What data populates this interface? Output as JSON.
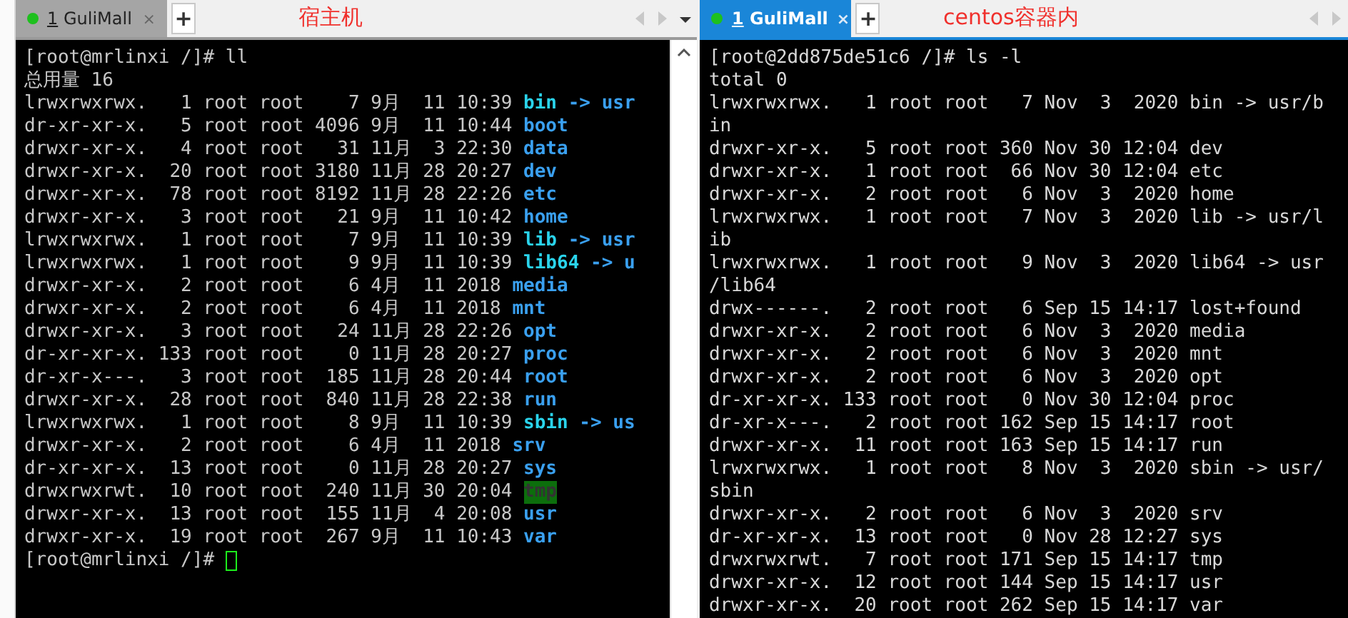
{
  "panes": [
    {
      "tab": {
        "number": "1",
        "label": "GuliMall",
        "close": "×",
        "selected": false
      },
      "add": "+",
      "note": "宿主机",
      "scrollbar": true,
      "lines": [
        {
          "text": "[root@mrlinxi /]# ll"
        },
        {
          "text": "总用量 16"
        },
        {
          "text": "lrwxrwxrwx.   1 root root    7 9月  11 10:39 ",
          "name": "bin",
          "kind": "link",
          "target": " -> usr"
        },
        {
          "text": "dr-xr-xr-x.   5 root root 4096 9月  11 10:44 ",
          "name": "boot",
          "kind": "dir"
        },
        {
          "text": "drwxr-xr-x.   4 root root   31 11月  3 22:30 ",
          "name": "data",
          "kind": "dir"
        },
        {
          "text": "drwxr-xr-x.  20 root root 3180 11月 28 20:27 ",
          "name": "dev",
          "kind": "dir"
        },
        {
          "text": "drwxr-xr-x.  78 root root 8192 11月 28 22:26 ",
          "name": "etc",
          "kind": "dir"
        },
        {
          "text": "drwxr-xr-x.   3 root root   21 9月  11 10:42 ",
          "name": "home",
          "kind": "dir"
        },
        {
          "text": "lrwxrwxrwx.   1 root root    7 9月  11 10:39 ",
          "name": "lib",
          "kind": "link",
          "target": " -> usr"
        },
        {
          "text": "lrwxrwxrwx.   1 root root    9 9月  11 10:39 ",
          "name": "lib64",
          "kind": "link",
          "target": " -> u"
        },
        {
          "text": "drwxr-xr-x.   2 root root    6 4月  11 2018 ",
          "name": "media",
          "kind": "dir"
        },
        {
          "text": "drwxr-xr-x.   2 root root    6 4月  11 2018 ",
          "name": "mnt",
          "kind": "dir"
        },
        {
          "text": "drwxr-xr-x.   3 root root   24 11月 28 22:26 ",
          "name": "opt",
          "kind": "dir"
        },
        {
          "text": "dr-xr-xr-x. 133 root root    0 11月 28 20:27 ",
          "name": "proc",
          "kind": "dir"
        },
        {
          "text": "dr-xr-x---.   3 root root  185 11月 28 20:44 ",
          "name": "root",
          "kind": "dir"
        },
        {
          "text": "drwxr-xr-x.  28 root root  840 11月 28 22:38 ",
          "name": "run",
          "kind": "dir"
        },
        {
          "text": "lrwxrwxrwx.   1 root root    8 9月  11 10:39 ",
          "name": "sbin",
          "kind": "link",
          "target": " -> us"
        },
        {
          "text": "drwxr-xr-x.   2 root root    6 4月  11 2018 ",
          "name": "srv",
          "kind": "dir"
        },
        {
          "text": "dr-xr-xr-x.  13 root root    0 11月 28 20:27 ",
          "name": "sys",
          "kind": "dir"
        },
        {
          "text": "drwxrwxrwt.  10 root root  240 11月 30 20:04 ",
          "name": "tmp",
          "kind": "sticky"
        },
        {
          "text": "drwxr-xr-x.  13 root root  155 11月  4 20:08 ",
          "name": "usr",
          "kind": "dir"
        },
        {
          "text": "drwxr-xr-x.  19 root root  267 9月  11 10:43 ",
          "name": "var",
          "kind": "dir"
        },
        {
          "text": "[root@mrlinxi /]# ",
          "cursor": true
        }
      ]
    },
    {
      "tab": {
        "number": "1",
        "label": "GuliMall",
        "close": "×",
        "selected": true
      },
      "add": "+",
      "note": "centos容器内",
      "scrollbar": false,
      "lines": [
        {
          "text": "[root@2dd875de51c6 /]# ls -l"
        },
        {
          "text": "total 0"
        },
        {
          "text": "lrwxrwxrwx.   1 root root   7 Nov  3  2020 bin -> usr/b"
        },
        {
          "text": "in"
        },
        {
          "text": "drwxr-xr-x.   5 root root 360 Nov 30 12:04 dev"
        },
        {
          "text": "drwxr-xr-x.   1 root root  66 Nov 30 12:04 etc"
        },
        {
          "text": "drwxr-xr-x.   2 root root   6 Nov  3  2020 home"
        },
        {
          "text": "lrwxrwxrwx.   1 root root   7 Nov  3  2020 lib -> usr/l"
        },
        {
          "text": "ib"
        },
        {
          "text": "lrwxrwxrwx.   1 root root   9 Nov  3  2020 lib64 -> usr"
        },
        {
          "text": "/lib64"
        },
        {
          "text": "drwx------.   2 root root   6 Sep 15 14:17 lost+found"
        },
        {
          "text": "drwxr-xr-x.   2 root root   6 Nov  3  2020 media"
        },
        {
          "text": "drwxr-xr-x.   2 root root   6 Nov  3  2020 mnt"
        },
        {
          "text": "drwxr-xr-x.   2 root root   6 Nov  3  2020 opt"
        },
        {
          "text": "dr-xr-xr-x. 133 root root   0 Nov 30 12:04 proc"
        },
        {
          "text": "dr-xr-x---.   2 root root 162 Sep 15 14:17 root"
        },
        {
          "text": "drwxr-xr-x.  11 root root 163 Sep 15 14:17 run"
        },
        {
          "text": "lrwxrwxrwx.   1 root root   8 Nov  3  2020 sbin -> usr/"
        },
        {
          "text": "sbin"
        },
        {
          "text": "drwxr-xr-x.   2 root root   6 Nov  3  2020 srv"
        },
        {
          "text": "dr-xr-xr-x.  13 root root   0 Nov 28 12:27 sys"
        },
        {
          "text": "drwxrwxrwt.   7 root root 171 Sep 15 14:17 tmp"
        },
        {
          "text": "drwxr-xr-x.  12 root root 144 Sep 15 14:17 usr"
        },
        {
          "text": "drwxr-xr-x.  20 root root 262 Sep 15 14:17 var"
        }
      ]
    }
  ]
}
